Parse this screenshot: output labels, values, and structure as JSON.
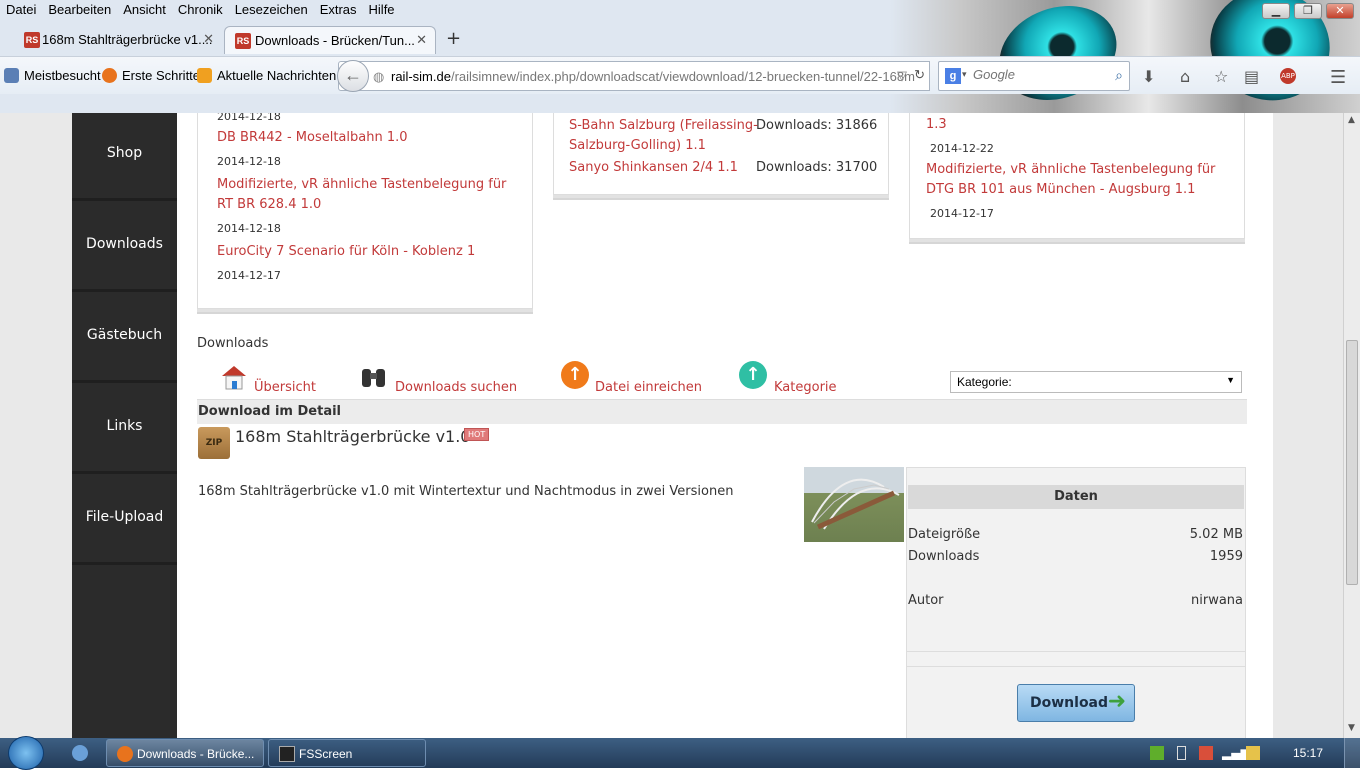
{
  "menubar": [
    "Datei",
    "Bearbeiten",
    "Ansicht",
    "Chronik",
    "Lesezeichen",
    "Extras",
    "Hilfe"
  ],
  "tabs": [
    {
      "label": "168m Stahlträgerbrücke v1....",
      "favicon": "RS"
    },
    {
      "label": "Downloads - Brücken/Tun...",
      "favicon": "RS"
    }
  ],
  "bookmarks": [
    "Meistbesucht",
    "Erste Schritte",
    "Aktuelle Nachrichten"
  ],
  "url": {
    "domain": "rail-sim.de",
    "path": "/railsimnew/index.php/downloadscat/viewdownload/12-bruecken-tunnel/22-168m"
  },
  "search": {
    "placeholder": "Google"
  },
  "sidebar": [
    "Shop",
    "Downloads",
    "Gästebuch",
    "Links",
    "File-Upload"
  ],
  "card1": [
    {
      "date": "2014-12-18"
    },
    {
      "link": "DB BR442 - Moseltalbahn 1.0",
      "date": "2014-12-18"
    },
    {
      "link": "Modifizierte, vR ähnliche Tastenbelegung für RT BR 628.4 1.0",
      "date": "2014-12-18"
    },
    {
      "link": "EuroCity 7 Scenario für Köln - Koblenz 1",
      "date": "2014-12-17"
    }
  ],
  "card2": [
    {
      "link": "S-Bahn Salzburg (Freilassing-Salzburg-Golling) 1.1",
      "downloads": "Downloads: 31866"
    },
    {
      "link": "Sanyo Shinkansen 2/4 1.1",
      "downloads": "Downloads: 31700"
    }
  ],
  "card3": [
    {
      "link": "1.3",
      "date": "2014-12-22"
    },
    {
      "link": "Modifizierte, vR ähnliche Tastenbelegung für DTG BR 101 aus München - Augsburg 1.1",
      "date": "2014-12-17"
    }
  ],
  "downloads_heading": "Downloads",
  "toolbar": {
    "overview": "Übersicht",
    "search": "Downloads suchen",
    "submit": "Datei einreichen",
    "category": "Kategorie"
  },
  "category_select": "Kategorie:",
  "detail_header": "Download im Detail",
  "file": {
    "title": "168m Stahlträgerbrücke v1.0",
    "badge": "HOT",
    "description": "168m Stahlträgerbrücke v1.0 mit Wintertextur und Nachtmodus in zwei Versionen",
    "icon_label": "ZIP"
  },
  "daten": {
    "header": "Daten",
    "rows": [
      {
        "k": "Dateigröße",
        "v": "5.02 MB"
      },
      {
        "k": "Downloads",
        "v": "1959"
      },
      {
        "k": "Autor",
        "v": "nirwana"
      }
    ],
    "button": "Download"
  },
  "taskbar": {
    "items": [
      "Downloads - Brücke...",
      "FSScreen"
    ],
    "clock": "15:17"
  }
}
